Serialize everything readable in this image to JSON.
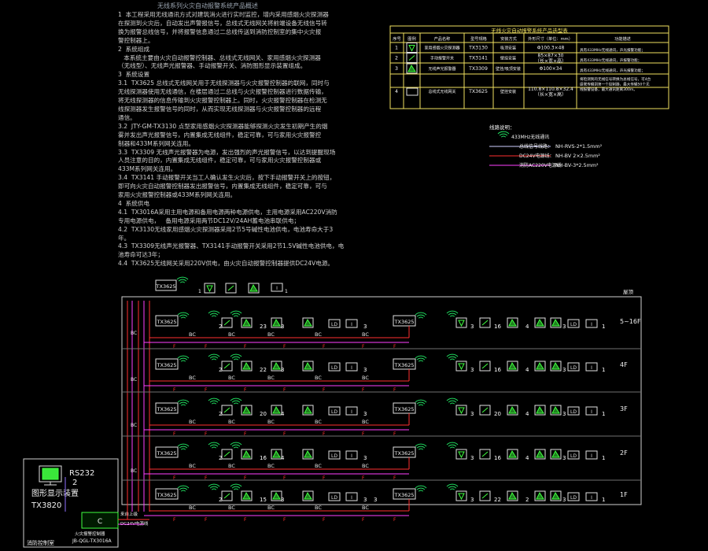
{
  "drawing_title": "无线系列火灾自动报警系统产品概述",
  "notes": [
    "1  本工程采用无线通讯方式对建筑消火进行实时监控，增内采用感烟火灾探测器",
    "在探测到火灾后，自动发出声警报信号，总线式无线网关将前端设备无线信号转",
    "换为报警总线信号，并将报警信息通过二总线传送到消防控制室的集中火灾报",
    "警控制器上。",
    "2  系统组成",
    "   本系统主要由火灾自动报警控制器、总线式无线网关、家用感烟火灾探测器",
    "（无线型）、无线声光报警器、手动报警开关、消防图形显示装置组成。",
    "3  系统设置",
    "3.1  TX3625 总线式无线网关用于无线探测器与火灾报警控制器的联网，同时与",
    "无线探测器使用无线通信，在楼层通过二总线与火灾报警控制器进行数据传输，",
    "将无线探测器的信息传输到火灾报警控制器上。同时，火灾报警控制器在检测无",
    "线探测器发生报警信号的同时，从而实现无线探测器与火灾报警控制器的远程",
    "通信。",
    "3.2  JTY-GM-TX3130 点型家用感烟火灾探测器能够探测火灾发生初期产生的烟",
    "雾并发出声光报警信号，内置集成无线组件，稳定可靠，可与家用火灾报警控",
    "制器和433M系列网关连用。",
    "3.3  TX3309 无线声光报警器为电源，发出强烈的声光报警信号，以达到提醒现场",
    "人员注意的目的，内置集成无线组件，稳定可靠，可与家用火灾报警控制器或",
    "433M系列网关连用。",
    "3.4  TX3141 手动报警开关当工人确认发生火灾后，按下手动报警开关上的按钮，",
    "即可向火灾自动报警控制器发出报警信号，内置集成无线组件，稳定可靠，可与",
    "家用火灾报警控制器或433M系列网关连用。",
    "4  系统供电",
    "4.1  TX3016A采用主用电源和备用电源两种电源供电，主用电源采用AC220V消防",
    "专用电源供电，   备用电源采用两节DC12V/24AH蓄电池串联供电；",
    "4.2  TX3130无线家用感烟火灾探测器采用2节5号碱性电池供电，电池寿命大于3",
    "年。",
    "4.3  TX3309无线声光报警器、TX3141手动报警开关采用2节1.5V碱性电池供电，电",
    "池寿命可达3年；",
    "4.4  TX3625无线网关采用220V供电，由火灾自动报警控制器提供DC24V电源。"
  ],
  "device_table": {
    "title": "无线火灾自动报警系统产品选型表",
    "headers": [
      "序号",
      "图例",
      "产品名称",
      "型号规格",
      "安装方式",
      "外形尺寸（单位：mm）",
      "功能描述"
    ],
    "rows": [
      {
        "no": "1",
        "icon": "smoke-detector-icon",
        "name": "家用感烟火灾探测器",
        "model": "TX3130",
        "mount": "吸顶安装",
        "size": "Φ100.3×48",
        "desc": "具有433MHz无线通讯，声光报警功能；"
      },
      {
        "no": "2",
        "icon": "manual-alarm-icon",
        "name": "手动报警开关",
        "model": "TX3141",
        "mount": "壁挂安装",
        "size": "85×87×30\n（长×宽×高）",
        "desc": "具有433MHz无线通讯，声报警功能；"
      },
      {
        "no": "3",
        "icon": "sounder-strobe-icon",
        "name": "无线声光报警器",
        "model": "TX3309",
        "mount": "壁挂/吸顶安装",
        "size": "Φ100×34",
        "desc": "具有433MHz无线通讯，声光报警功能；"
      },
      {
        "no": "4",
        "icon": "gateway-icon",
        "name": "总线式无线网关",
        "model": "TX3625",
        "mount": "壁挂安装",
        "size": "110.8×110.8×32.4\n（长×宽×高）",
        "desc": "将检测到的无线信号转换为总线信号，可4台\n级联传输到第一个控制器，最大传输50个无\n线报警设备，最大通讯距离300m。"
      }
    ]
  },
  "legend": {
    "title": "线路说明：",
    "items": [
      {
        "label": "433MHz无线通讯"
      },
      {
        "label": "总线信号线路：",
        "spec": "NH-RVS-2*1.5mm²"
      },
      {
        "label": "DC24V电源线：",
        "spec": "NH-BV 2×2.5mm²"
      },
      {
        "label": "消防AC220V电源线",
        "spec": "NH-BV-3*2.5mm²"
      }
    ]
  },
  "riser": {
    "gateway_model": "TX3625",
    "bus_label": "BC",
    "power_label": "F",
    "roof_label": "屋顶",
    "floors": [
      {
        "label": "5~16F",
        "left_counts": [
          "2",
          "23",
          "3",
          "3"
        ],
        "right_counts": [
          "3",
          "16",
          "4",
          "3",
          "1"
        ]
      },
      {
        "label": "4F",
        "left_counts": [
          "2",
          "22",
          "3",
          "3"
        ],
        "right_counts": [
          "3",
          "16",
          "4",
          "3",
          "1"
        ]
      },
      {
        "label": "3F",
        "left_counts": [
          "2",
          "20",
          "4",
          "3"
        ],
        "right_counts": [
          "3",
          "20",
          "4",
          "3",
          "1"
        ]
      },
      {
        "label": "2F",
        "left_counts": [
          "2",
          "16",
          "4",
          "3"
        ],
        "right_counts": [
          "3",
          "16",
          "4",
          "3",
          "1"
        ]
      },
      {
        "label": "1F",
        "left_counts": [
          "2",
          "15",
          "3",
          "3",
          "3"
        ],
        "right_counts": [
          "3",
          "22",
          "2",
          "3",
          "1"
        ]
      }
    ],
    "roof_counts": [
      "1",
      "1"
    ]
  },
  "control_room": {
    "rs232": "RS232",
    "port": "2",
    "display_name": "图形显示装置",
    "display_model": "TX3820",
    "panel_glyph": "C",
    "panel_label": "火灾报警控制器",
    "panel_model": "JB-QGL-TX3016A",
    "room_label": "消防控制室",
    "from_label": "来自上级",
    "dc_label": "DC24V电源线"
  },
  "colors": {
    "bus": "#ff3030",
    "power": "#ff40ff",
    "wireless": "#20e060",
    "frame": "#e8e8e8",
    "device": "#40ff40",
    "table": "#f0e060"
  }
}
